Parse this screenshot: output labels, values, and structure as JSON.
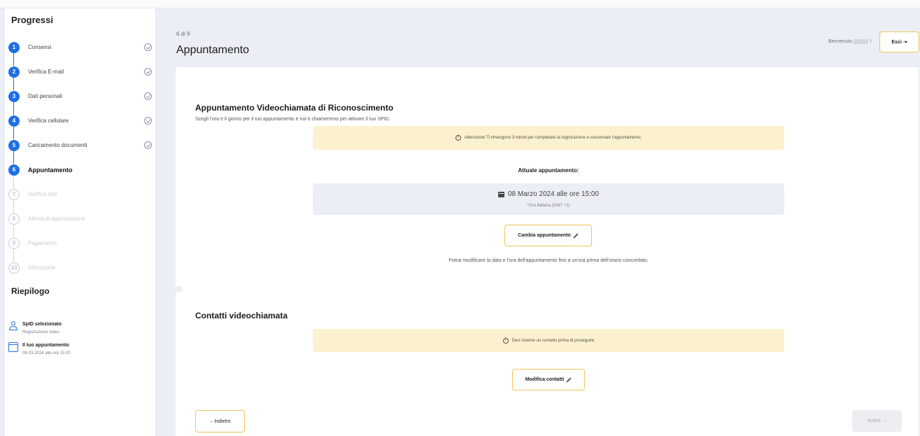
{
  "sidebar": {
    "title": "Progressi",
    "steps": [
      {
        "num": "1",
        "label": "Consensi",
        "state": "done"
      },
      {
        "num": "2",
        "label": "Verifica E-mail",
        "state": "done"
      },
      {
        "num": "3",
        "label": "Dati personali",
        "state": "done"
      },
      {
        "num": "4",
        "label": "Verifica cellulare",
        "state": "done"
      },
      {
        "num": "5",
        "label": "Caricamento documenti",
        "state": "done"
      },
      {
        "num": "6",
        "label": "Appuntamento",
        "state": "current"
      },
      {
        "num": "7",
        "label": "Verifica dati",
        "state": "pending"
      },
      {
        "num": "8",
        "label": "Attesa di approvazione",
        "state": "pending"
      },
      {
        "num": "9",
        "label": "Pagamento",
        "state": "pending"
      },
      {
        "num": "10",
        "label": "Attivazione",
        "state": "pending"
      }
    ],
    "summary": {
      "title": "Riepilogo",
      "spid_label": "SpID selezionato",
      "spid_value": "Registrazione video",
      "appt_label": "Il tuo appuntamento",
      "appt_value": "08-03-2024 alle ore 15:00"
    }
  },
  "header": {
    "step_count": "6 di 9",
    "title": "Appuntamento",
    "welcome_prefix": "Benvenuto",
    "welcome_suffix": "!",
    "logout_label": "Esci ⇥"
  },
  "appointment_section": {
    "title": "Appuntamento Videochiamata di Riconoscimento",
    "subtitle": "Scegli l'ora e il giorno per il tuo appuntamento e noi ti chiameremo per attivare il tuo SPID.",
    "warning": "Attenzione! Ti rimangono 3 minuti per completare la registrazione e conservare l'appuntamento.",
    "current_label": "Attuale appuntamento:",
    "current_value": "08 Marzo 2024 alle ore 15:00",
    "timezone_note": "*Ora Italiana (GMT +1)",
    "change_button": "Cambia appuntamento",
    "info": "Potrai modificare la data e l'ora dell'appuntamento fino a un'ora prima dell'orario concordato."
  },
  "contacts_section": {
    "title": "Contatti videochiamata",
    "warning": "Devi inserire un contatto prima di proseguire",
    "edit_button": "Modifica contatti"
  },
  "footer": {
    "back_button": "←Indietro",
    "next_button": "Avanti →"
  },
  "colors": {
    "accent": "#1f6fe5",
    "warning_bg": "#fbf1cf",
    "button_border": "#f0c45a"
  }
}
